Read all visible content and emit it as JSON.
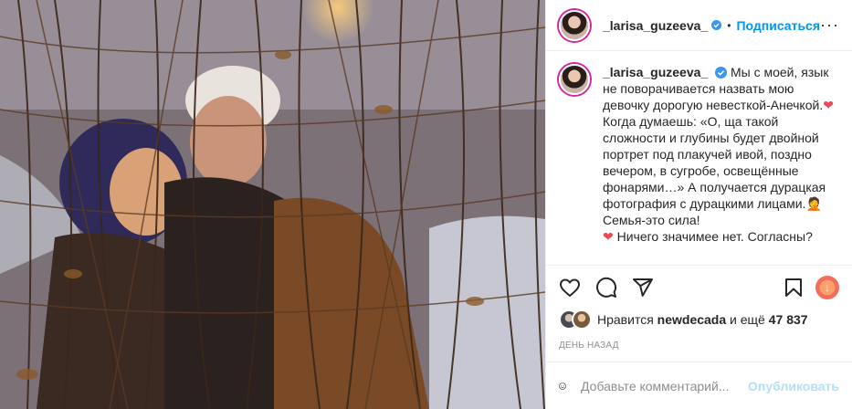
{
  "photo": {
    "alt_icon": "photo-content"
  },
  "header": {
    "username": "_larisa_guzeeva_",
    "separator": "•",
    "follow_label": "Подписаться",
    "more_label": "···"
  },
  "caption": {
    "username": "_larisa_guzeeva_",
    "text_1": " Мы с моей, язык не поворачивается назвать мою девочку дорогую невесткой-Анечкой.",
    "heart_1": "❤",
    "text_2": " Когда думаешь: «О, ща такой сложности и глубины будет двойной портрет под плакучей ивой, поздно вечером, в сугробе, освещённые фонарями…» А получается дурацкая фотография с дурацкими лицами.",
    "emoji_1": "🤦",
    "text_3": "Семья-это сила!",
    "heart_2": "❤",
    "text_4": " Ничего значимее нет. Согласны?"
  },
  "actions": {
    "like_icon": "heart-icon",
    "comment_icon": "comment-icon",
    "share_icon": "share-icon",
    "save_icon": "bookmark-icon",
    "extension_icon": "download-extension-icon"
  },
  "likes": {
    "prefix": "Нравится ",
    "liked_by": "newdecada",
    "middle": " и ещё ",
    "count": "47 837"
  },
  "timestamp": "ДЕНЬ НАЗАД",
  "comment": {
    "placeholder": "Добавьте комментарий...",
    "publish_label": "Опубликовать"
  },
  "colors": {
    "accent": "#0095f6",
    "publish_disabled": "#b2dffc",
    "heart": "#ed4956",
    "verified": "#3897f0"
  }
}
